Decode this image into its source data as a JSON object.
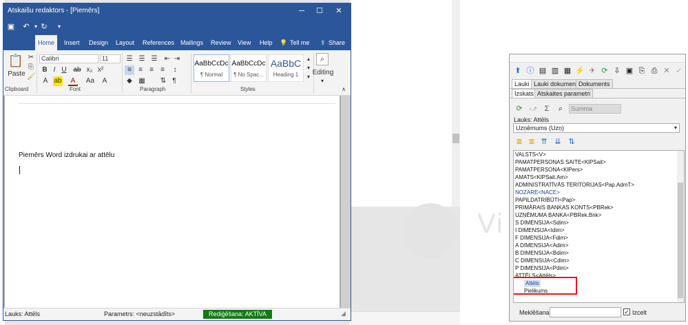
{
  "word": {
    "title": "Atskaišu redaktors  - [Piemērs]",
    "tabs": [
      "Home",
      "Insert",
      "Design",
      "Layout",
      "References",
      "Mailings",
      "Review",
      "View",
      "Help"
    ],
    "tell_me": "Tell me",
    "share": "Share",
    "clipboard": {
      "paste": "Paste",
      "label": "Clipboard"
    },
    "font": {
      "name": "Calibri",
      "size": "11",
      "label": "Font"
    },
    "paragraph_label": "Paragraph",
    "styles": {
      "items": [
        {
          "preview": "AaBbCcDc",
          "name": "¶ Normal"
        },
        {
          "preview": "AaBbCcDc",
          "name": "¶ No Spac..."
        },
        {
          "preview": "AaBbC",
          "name": "Heading 1"
        }
      ],
      "label": "Styles"
    },
    "editing": "Editing",
    "document": {
      "text": "Piemērs Word izdrukai ar attēlu"
    },
    "status": {
      "field": "Lauks: Attēls",
      "param": "Parametrs: <neuzstādīts>",
      "editing": "Rediģēšana: AKTĪVA"
    }
  },
  "panel": {
    "tabs": [
      "Lauki",
      "Lauki dokumentā",
      "Dokuments"
    ],
    "subtabs": [
      "Izskats",
      "Atskaites parametri"
    ],
    "summa": "Summa",
    "field_label": "Lauks: Attēls",
    "select_value": "Uzņēmums (Uzņ)",
    "items": [
      {
        "text": "VALSTS<V>",
        "indent": 0,
        "blue": false
      },
      {
        "text": "PAMATPERSONAS SAITE<KlPSait>",
        "indent": 0,
        "blue": false
      },
      {
        "text": "PAMATPERSONA<KlPers>",
        "indent": 0,
        "blue": false
      },
      {
        "text": "AMATS<KlPSait.Am>",
        "indent": 0,
        "blue": false
      },
      {
        "text": "ADMINISTRATĪVĀS TERITORIJAS<Pap.AdmT>",
        "indent": 0,
        "blue": false
      },
      {
        "text": "NOZARE<NACE>",
        "indent": 0,
        "blue": true
      },
      {
        "text": "PAPILDATRIBŪTI<Pap>",
        "indent": 0,
        "blue": false
      },
      {
        "text": "PRIMĀRAIS BANKAS KONTS<PBRek>",
        "indent": 0,
        "blue": false
      },
      {
        "text": "UZŅĒMUMA BANKA<PBRek.Bnk>",
        "indent": 0,
        "blue": false
      },
      {
        "text": "S DIMENSIJA<Sdim>",
        "indent": 0,
        "blue": false
      },
      {
        "text": "I DIMENSIJA<Idim>",
        "indent": 0,
        "blue": false
      },
      {
        "text": "F DIMENSIJA<Fdim>",
        "indent": 0,
        "blue": false
      },
      {
        "text": "A DIMENSIJA<Adim>",
        "indent": 0,
        "blue": false
      },
      {
        "text": "B DIMENSIJA<Bdim>",
        "indent": 0,
        "blue": false
      },
      {
        "text": "C DIMENSIJA<Cdim>",
        "indent": 0,
        "blue": false
      },
      {
        "text": "P DIMENSIJA<Pdim>",
        "indent": 0,
        "blue": false
      },
      {
        "text": "ATTĒLS<Attēls>",
        "indent": 0,
        "blue": false
      },
      {
        "text": "Attēls",
        "indent": 1,
        "blue": true
      },
      {
        "text": "Pielikums",
        "indent": 1,
        "blue": false
      }
    ],
    "search_label": "Meklēšana:",
    "izcelt": "Izcelt",
    "izcelt_checked": true
  },
  "colors": {
    "word_blue": "#2b579a",
    "status_green": "#107c10",
    "highlight_red": "#e81123"
  }
}
